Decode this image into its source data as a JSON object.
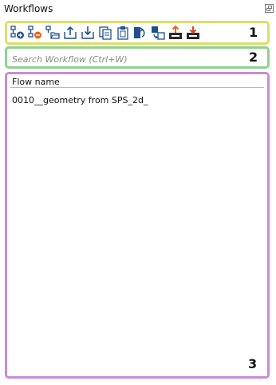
{
  "panel": {
    "title": "Workflows"
  },
  "toolbar": {
    "buttons": [
      {
        "icon": "add-workflow-icon"
      },
      {
        "icon": "remove-workflow-icon"
      },
      {
        "icon": "open-folder-icon"
      },
      {
        "icon": "export-icon"
      },
      {
        "icon": "import-icon"
      },
      {
        "icon": "copy-icon"
      },
      {
        "icon": "paste-icon"
      },
      {
        "icon": "rename-icon"
      },
      {
        "icon": "refresh-icon"
      },
      {
        "icon": "upload-icon"
      },
      {
        "icon": "download-icon"
      }
    ]
  },
  "search": {
    "placeholder": "Search Workflow (Ctrl+W)",
    "value": ""
  },
  "list": {
    "column_header": "Flow name",
    "rows": [
      {
        "name": "0010__geometry from SPS_2d_"
      }
    ]
  },
  "callouts": {
    "toolbar": "1",
    "search": "2",
    "list": "3"
  },
  "colors": {
    "toolbar_outline": "#d9df6a",
    "search_outline": "#8fd08f",
    "list_outline": "#c98bd6",
    "icon_blue": "#1f4f8f",
    "icon_orange": "#e8661a",
    "icon_red": "#d9461c"
  }
}
